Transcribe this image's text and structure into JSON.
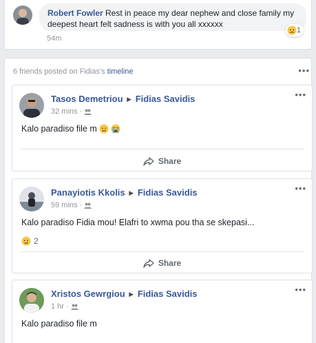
{
  "top_comment": {
    "author": "Robert Fowler",
    "text": "Rest in peace my dear nephew and close family my deepest heart felt sadness is with you all xxxxxx",
    "time": "54m",
    "reaction_count": "1"
  },
  "friends_section": {
    "header_prefix": "6 friends posted on Fidias's",
    "header_link": "timeline",
    "more": "•••"
  },
  "posts": [
    {
      "author": "Tasos Demetriou",
      "target": "Fidias Savidis",
      "time": "32 mins ·",
      "text": "Kalo paradiso file m",
      "share": "Share",
      "more": "•••"
    },
    {
      "author": "Panayiotis Kkolis",
      "target": "Fidias Savidis",
      "time": "59 mins ·",
      "text": "Kalo paradiso Fidia mou! Elafri to xwma pou tha se skepasi...",
      "reaction_count": "2",
      "share": "Share",
      "more": "•••"
    },
    {
      "author": "Xristos Gewrgiou",
      "target": "Fidias Savidis",
      "time": "1 hr ·",
      "text": "Kalo paradiso file m",
      "more": "•••"
    }
  ],
  "colors": {
    "link": "#385898",
    "meta": "#90949c",
    "background": "#e9ebee"
  }
}
